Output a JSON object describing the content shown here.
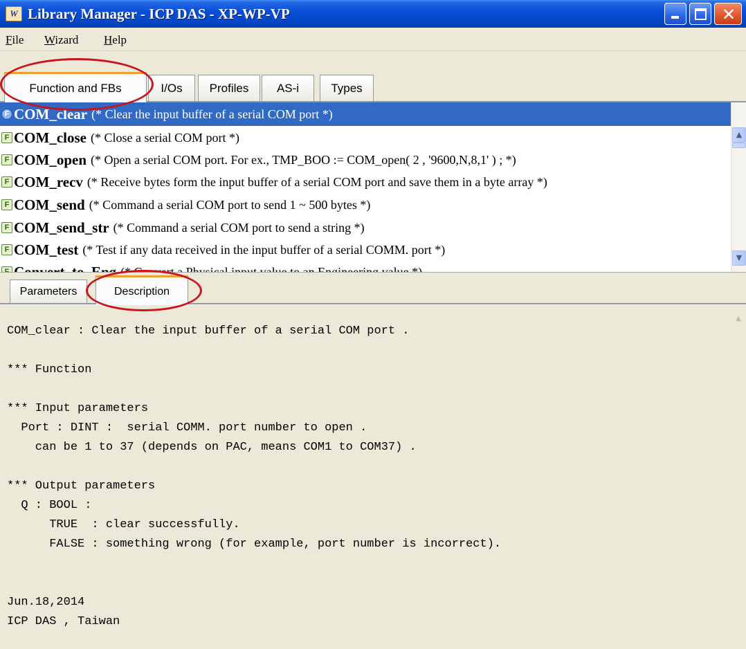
{
  "window": {
    "title": "Library Manager - ICP DAS - XP-WP-VP",
    "app_icon_text": "W"
  },
  "menu": [
    "File",
    "Wizard",
    "Help"
  ],
  "top_tabs": [
    {
      "label": "Function and FBs",
      "active": true
    },
    {
      "label": "I/Os",
      "active": false
    },
    {
      "label": "Profiles",
      "active": false
    },
    {
      "label": "AS-i",
      "active": false
    },
    {
      "label": "Types",
      "active": false
    }
  ],
  "functions": [
    {
      "name": "COM_clear",
      "desc": "(* Clear the input buffer of a serial COM port *)",
      "selected": true
    },
    {
      "name": "COM_close",
      "desc": "(* Close a serial COM port *)",
      "selected": false
    },
    {
      "name": "COM_open",
      "desc": "(* Open a serial COM port. For ex., TMP_BOO := COM_open( 2 , '9600,N,8,1' ) ; *)",
      "selected": false
    },
    {
      "name": "COM_recv",
      "desc": "(* Receive bytes form the input buffer of a serial COM port and save them in a byte array *)",
      "selected": false
    },
    {
      "name": "COM_send",
      "desc": "(* Command a serial COM port to send 1 ~ 500 bytes *)",
      "selected": false
    },
    {
      "name": "COM_send_str",
      "desc": "(* Command a serial COM port to send a string *)",
      "selected": false
    },
    {
      "name": "COM_test",
      "desc": "(* Test if any data received in the input buffer of a serial COMM. port *)",
      "selected": false
    },
    {
      "name": "Convert_to_Eng",
      "desc": "(* Convert a Physical input value to an Engineering value *)",
      "selected": false
    }
  ],
  "bottom_tabs": [
    {
      "label": "Parameters",
      "active": false
    },
    {
      "label": "Description",
      "active": true
    }
  ],
  "description_lines": [
    "COM_clear : Clear the input buffer of a serial COM port .",
    "",
    "*** Function",
    "",
    "*** Input parameters",
    "  Port : DINT :  serial COMM. port number to open .",
    "    can be 1 to 37 (depends on PAC, means COM1 to COM37) .",
    "",
    "*** Output parameters",
    "  Q : BOOL :",
    "      TRUE  : clear successfully.",
    "      FALSE : something wrong (for example, port number is incorrect).",
    "",
    "",
    "Jun.18,2014",
    "ICP DAS , Taiwan"
  ],
  "icons": {
    "function_icon": "function-badge-icon",
    "scroll_up": "arrow-up-icon",
    "scroll_down": "arrow-down-icon"
  },
  "colors": {
    "title_bar": "#0a50d8",
    "selection": "#316ac5",
    "annotation": "#c8141c",
    "tab_highlight": "#f0a030"
  }
}
